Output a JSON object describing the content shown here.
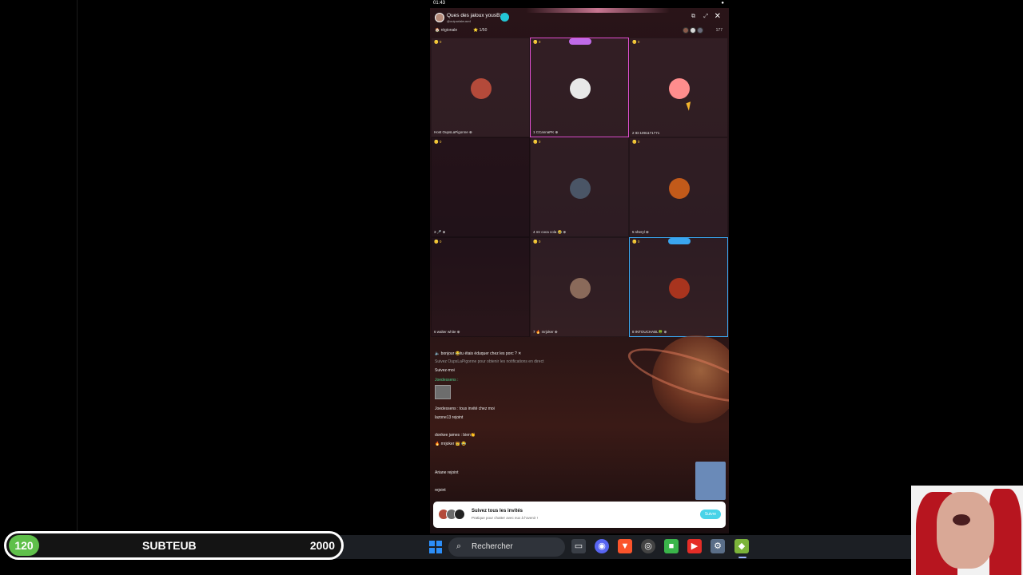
{
  "status_bar": {
    "time": "01:43",
    "indicator": "●"
  },
  "live": {
    "room_title": "Ques des jaloux yousBz",
    "room_subtitle": "@ouiparlaleuse4",
    "region": "🏠 régionale",
    "rank": "⭐ 1/50",
    "viewer_count": "177",
    "share_icon": "external-link-icon",
    "expand_icon": "expand-icon",
    "close_icon": "close-icon",
    "close_glyph": "✕",
    "share_glyph": "⧉",
    "expand_glyph": "⤢"
  },
  "grid": [
    {
      "coins": "🪙 0",
      "name": "Host OupsLaPigonne ⊕",
      "avatar_color": "#b44a3a"
    },
    {
      "coins": "🪙 0",
      "name": "1 CCannaPK ⊕",
      "avatar_color": "#e8e8e8"
    },
    {
      "coins": "🪙 0",
      "name": "2 ID:1091171771",
      "avatar_color": "#ff8d8d"
    },
    {
      "coins": "🪙 0",
      "name": "3 🎤 ⊕",
      "avatar_color": ""
    },
    {
      "coins": "🪙 0",
      "name": "4 mr coca cola 😂 ⊕",
      "avatar_color": "#4a5566"
    },
    {
      "coins": "🪙 0",
      "name": "5 sheryl ⊕",
      "avatar_color": "#c25a1a"
    },
    {
      "coins": "🪙 0",
      "name": "6 walter white ⊕",
      "avatar_color": ""
    },
    {
      "coins": "🪙 0",
      "name": "7 🔥 mrjoker ⊕",
      "avatar_color": "#8a6a5a"
    },
    {
      "coins": "🪙 0",
      "name": "8 INTOUCHABL🍀 ⊕",
      "avatar_color": "#a8341e"
    }
  ],
  "chat": [
    "🔈 bonjour 😂tu étais éduquer chez les porc ? ✕",
    "Suivez OupsLaPigonne pour obtenir les notifications en direct",
    "Suivez-moi",
    "Joedessens :",
    "Joedessens : tous invité chez moi",
    "lazone13 rejoint",
    "donkee james : bien👏",
    "🔥 mrjoker 👑 😂",
    "Ariane rejoint",
    "rejoint"
  ],
  "follow_banner": {
    "title": "Suivez tous les invités",
    "subtitle": "Pratique pour chatter avec eux à l'avenir !",
    "button": "Suivre"
  },
  "taskbar": {
    "search_text": "Rechercher",
    "search_icon": "search-icon",
    "search_glyph": "⌕",
    "icons": [
      {
        "name": "file-explorer-icon",
        "color": "#3a3f47",
        "glyph": "▭"
      },
      {
        "name": "discord-icon",
        "color": "#5865f2",
        "glyph": "◉"
      },
      {
        "name": "brave-icon",
        "color": "#fb542b",
        "glyph": "▼"
      },
      {
        "name": "obs-icon",
        "color": "#444",
        "glyph": "◎"
      },
      {
        "name": "green-app-icon",
        "color": "#3ab54a",
        "glyph": "■"
      },
      {
        "name": "youtube-icon",
        "color": "#e52d27",
        "glyph": "▶"
      },
      {
        "name": "settings-icon",
        "color": "#5a6e88",
        "glyph": "⚙"
      },
      {
        "name": "bluestacks-icon",
        "color": "#7bb33a",
        "glyph": "◆"
      }
    ]
  },
  "goal": {
    "current": "120",
    "title": "SUBTEUB",
    "target": "2000",
    "accent": "#5fc04a"
  }
}
